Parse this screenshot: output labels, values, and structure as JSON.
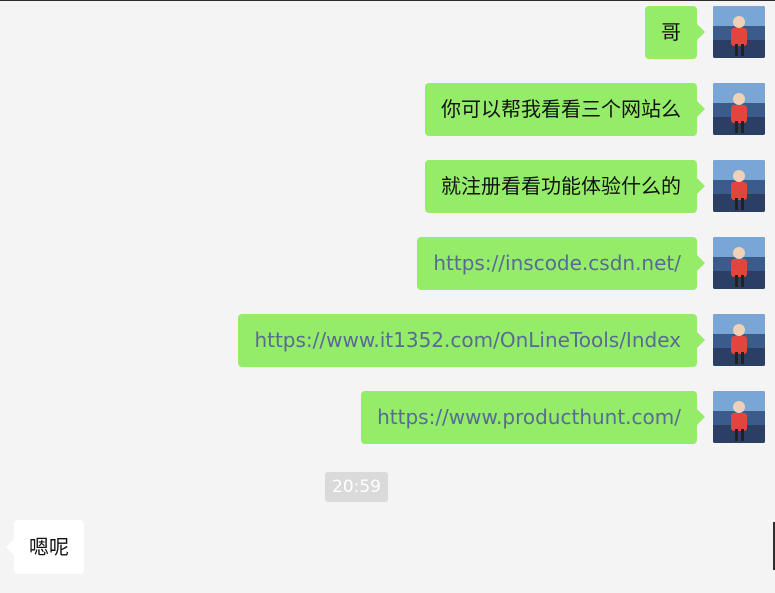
{
  "messages": [
    {
      "text": "哥",
      "is_link": false
    },
    {
      "text": "你可以帮我看看三个网站么",
      "is_link": false
    },
    {
      "text": "就注册看看功能体验什么的",
      "is_link": false
    },
    {
      "text": "https://inscode.csdn.net/",
      "is_link": true
    },
    {
      "text": "https://www.it1352.com/OnLineTools/Index",
      "is_link": true
    },
    {
      "text": "https://www.producthunt.com/",
      "is_link": true
    }
  ],
  "timestamp": "20:59",
  "incoming": {
    "text": "嗯呢"
  },
  "colors": {
    "outgoing_bubble": "#95ec69",
    "link_text": "#576b95",
    "incoming_bubble": "#ffffff",
    "background": "#f4f4f4",
    "timestamp_bg": "#dadada"
  },
  "icons": {
    "avatar": "avatar-photo-icon"
  }
}
